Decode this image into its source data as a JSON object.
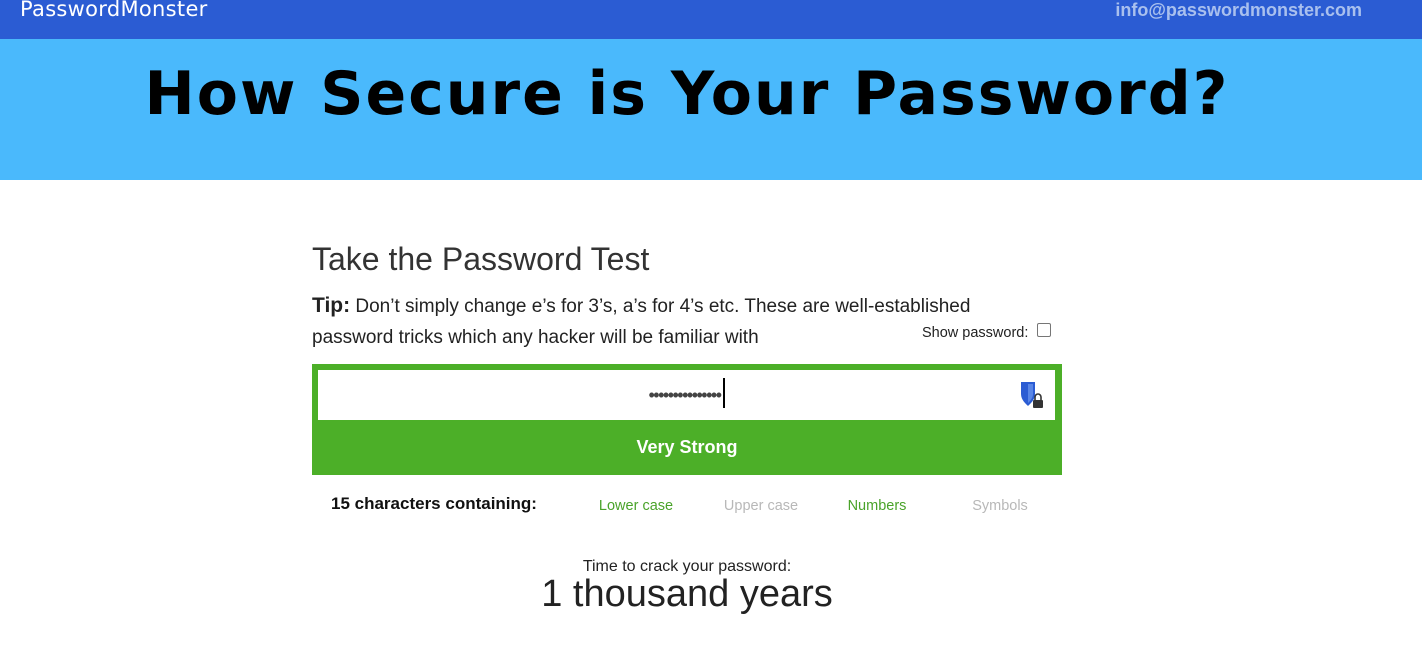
{
  "header": {
    "brand": "PasswordMonster",
    "email": "info@passwordmonster.com",
    "background": "#2b5cd3"
  },
  "banner": {
    "headline": "How Secure is Your Password?",
    "background": "#4ab9fc"
  },
  "test": {
    "title": "Take the Password Test",
    "tip_label": "Tip:",
    "tip_text": " Don’t simply change e’s for 3’s, a’s for 4’s etc. These are well-established password tricks which any hacker will be familiar with",
    "show_password_label": "Show password:",
    "show_password_checked": false
  },
  "password_field": {
    "masked_value": "•••••••••••••••",
    "icon": "password-manager-shield-icon"
  },
  "strength": {
    "label": "Very Strong",
    "color": "#4caf28"
  },
  "composition": {
    "summary": "15 characters containing:",
    "types": [
      {
        "label": "Lower case",
        "present": true
      },
      {
        "label": "Upper case",
        "present": false
      },
      {
        "label": "Numbers",
        "present": true
      },
      {
        "label": "Symbols",
        "present": false
      }
    ]
  },
  "crack_time": {
    "label": "Time to crack your password:",
    "value": "1 thousand years"
  }
}
